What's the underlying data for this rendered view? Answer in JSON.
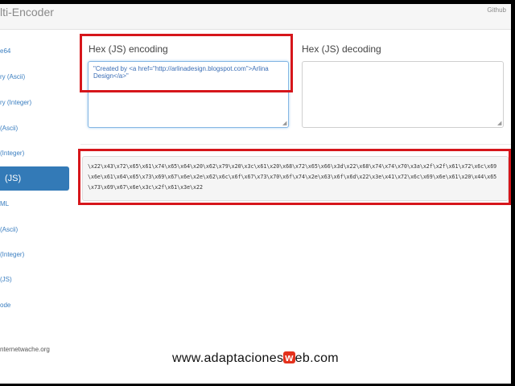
{
  "navbar": {
    "brand": "lti-Encoder",
    "github_link": "Github"
  },
  "sidebar": {
    "items": [
      {
        "label": "e64",
        "active": false
      },
      {
        "label": "ry (Ascii)",
        "active": false
      },
      {
        "label": "ry (Integer)",
        "active": false
      },
      {
        "label": "(Ascii)",
        "active": false
      },
      {
        "label": "(Integer)",
        "active": false
      },
      {
        "label": "(JS)",
        "active": true
      },
      {
        "label": "ML",
        "active": false
      },
      {
        "label": "(Ascii)",
        "active": false
      },
      {
        "label": "(Integer)",
        "active": false
      },
      {
        "label": "(JS)",
        "active": false
      },
      {
        "label": "ode",
        "active": false
      },
      {
        "label": "nternetwache.org",
        "active": false
      }
    ]
  },
  "encoding": {
    "label": "Hex (JS) encoding",
    "value": "\"Created by <a href=\"http://arlinadesign.blogspot.com\">Arlina Design</a>\""
  },
  "decoding": {
    "label": "Hex (JS) decoding",
    "value": ""
  },
  "output": {
    "value": "\\x22\\x43\\x72\\x65\\x61\\x74\\x65\\x64\\x20\\x62\\x79\\x20\\x3c\\x61\\x20\\x68\\x72\\x65\\x66\\x3d\\x22\\x68\\x74\\x74\\x70\\x3a\\x2f\\x2f\\x61\\x72\\x6c\\x69\\x6e\\x61\\x64\\x65\\x73\\x69\\x67\\x6e\\x2e\\x62\\x6c\\x6f\\x67\\x73\\x70\\x6f\\x74\\x2e\\x63\\x6f\\x6d\\x22\\x3e\\x41\\x72\\x6c\\x69\\x6e\\x61\\x20\\x44\\x65\\x73\\x69\\x67\\x6e\\x3c\\x2f\\x61\\x3e\\x22"
  },
  "watermark": {
    "prefix": "www.adaptaciones",
    "highlight": "w",
    "suffix": "eb.com"
  },
  "colors": {
    "accent": "#337ab7",
    "highlight_border": "#d6161b"
  }
}
